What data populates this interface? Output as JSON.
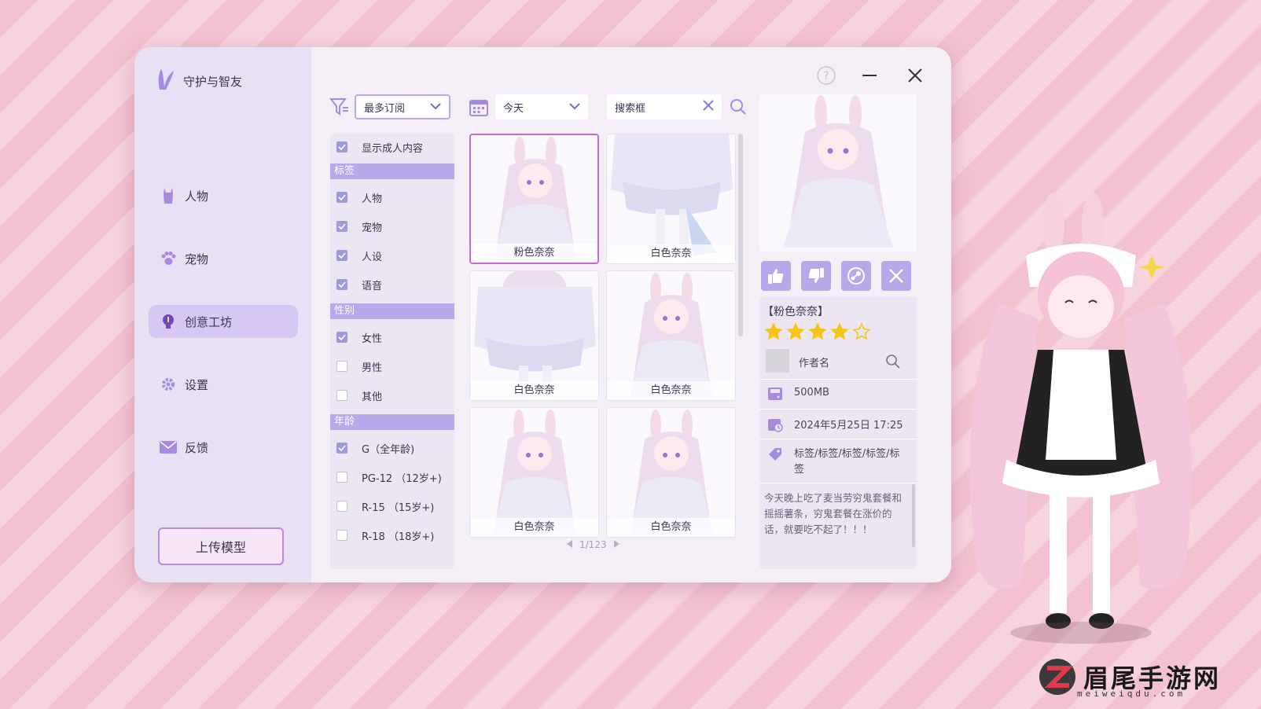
{
  "app": {
    "title": "守护与智友"
  },
  "sidebar": {
    "items": [
      {
        "label": "人物",
        "icon": "bunny-person-icon"
      },
      {
        "label": "宠物",
        "icon": "paw-icon"
      },
      {
        "label": "创意工坊",
        "icon": "lightbulb-icon",
        "active": true
      },
      {
        "label": "设置",
        "icon": "gear-icon"
      },
      {
        "label": "反馈",
        "icon": "mail-icon"
      }
    ],
    "upload_label": "上传模型"
  },
  "toolbar": {
    "sort_value": "最多订阅",
    "date_value": "今天",
    "search_placeholder": "搜索框"
  },
  "filters": {
    "adult_label": "显示成人内容",
    "tags_header": "标签",
    "tags": [
      "人物",
      "宠物",
      "人设",
      "语音"
    ],
    "gender_header": "性别",
    "genders": [
      "女性",
      "男性",
      "其他"
    ],
    "age_header": "年龄",
    "ages": [
      "G（全年龄)",
      "PG-12 （12岁+)",
      "R-15 （15岁+)",
      "R-18 （18岁+)"
    ]
  },
  "grid": {
    "cards": [
      {
        "name": "粉色奈奈",
        "selected": true
      },
      {
        "name": "白色奈奈"
      },
      {
        "name": "白色奈奈"
      },
      {
        "name": "白色奈奈"
      },
      {
        "name": "白色奈奈"
      },
      {
        "name": "白色奈奈"
      }
    ],
    "pagination": "1/123"
  },
  "detail": {
    "title": "【粉色奈奈】",
    "rating": 4,
    "rating_max": 5,
    "author": "作者名",
    "size": "500MB",
    "date": "2024年5月25日 17:25",
    "tags": "标签/标签/标签/标签/标签",
    "description": "今天晚上吃了麦当劳穷鬼套餐和摇摇薯条，穷鬼套餐在涨价的话，就要吃不起了！！！"
  },
  "watermark": {
    "text": "眉尾手游网",
    "sub": "meiweiqdu.com"
  },
  "colors": {
    "accent": "#b7a8ea",
    "selected_border": "#c06ad8",
    "sidebar_bg": "#e8e0f3",
    "star": "#f5c518"
  }
}
